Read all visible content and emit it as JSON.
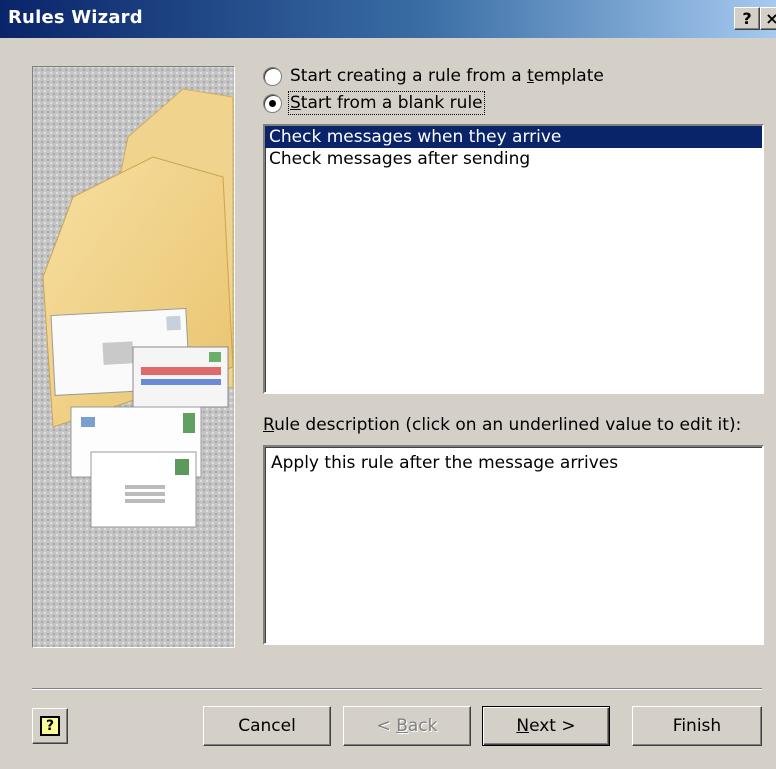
{
  "window": {
    "title": "Rules Wizard",
    "help_glyph": "?",
    "close_glyph": "×"
  },
  "options": {
    "template": {
      "pre": "Start creating a rule from a ",
      "accel": "t",
      "post": "emplate",
      "selected": false
    },
    "blank": {
      "accel": "S",
      "post": "tart from a blank rule",
      "selected": true
    }
  },
  "rule_list": {
    "items": [
      "Check messages when they arrive",
      "Check messages after sending"
    ],
    "selected_index": 0
  },
  "description": {
    "label_accel": "R",
    "label_post": "ule description (click on an underlined value to edit it):",
    "text": "Apply this rule after the message arrives"
  },
  "buttons": {
    "help_glyph": "?",
    "cancel": "Cancel",
    "back": {
      "pre": "< ",
      "accel": "B",
      "post": "ack",
      "disabled": true
    },
    "next": {
      "accel": "N",
      "post": "ext >"
    },
    "finish": "Finish"
  },
  "colors": {
    "title_bar_start": "#0a246a",
    "selection": "#0a246a",
    "dialog_face": "#d4d0c8"
  },
  "icons": {
    "illustration": "folder-with-envelopes-illustration",
    "help_button": "help-question-icon"
  }
}
